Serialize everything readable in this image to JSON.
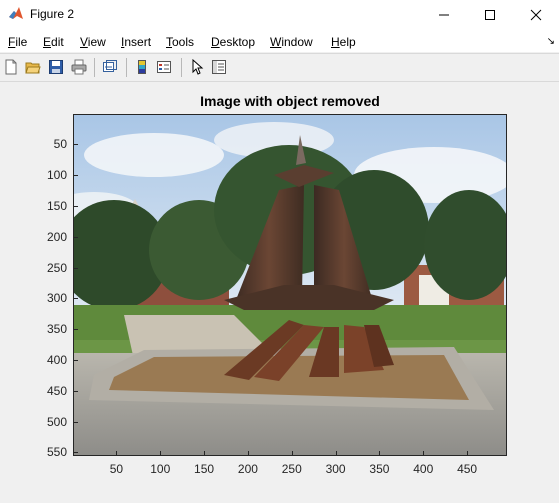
{
  "window": {
    "title": "Figure 2",
    "controls": {
      "minimize": "minimize",
      "maximize": "maximize",
      "close": "close"
    }
  },
  "menu": [
    {
      "label": "File",
      "u": "F",
      "rest": "ile"
    },
    {
      "label": "Edit",
      "u": "E",
      "rest": "dit"
    },
    {
      "label": "View",
      "u": "V",
      "rest": "iew"
    },
    {
      "label": "Insert",
      "u": "I",
      "rest": "nsert"
    },
    {
      "label": "Tools",
      "u": "T",
      "rest": "ools"
    },
    {
      "label": "Desktop",
      "u": "D",
      "rest": "esktop"
    },
    {
      "label": "Window",
      "u": "W",
      "rest": "indow"
    },
    {
      "label": "Help",
      "u": "H",
      "rest": "elp"
    }
  ],
  "toolbar": [
    "new-figure",
    "open-file",
    "save",
    "print",
    "link-plot",
    "insert-colorbar",
    "insert-legend",
    "edit-plot",
    "property-inspector"
  ],
  "figure": {
    "title": "Image with object removed",
    "x_ticks": [
      "50",
      "100",
      "150",
      "200",
      "250",
      "300",
      "350",
      "400",
      "450"
    ],
    "y_ticks": [
      "50",
      "100",
      "150",
      "200",
      "250",
      "300",
      "350",
      "400",
      "450",
      "500",
      "550"
    ],
    "image_description_icon": "photo-image"
  }
}
